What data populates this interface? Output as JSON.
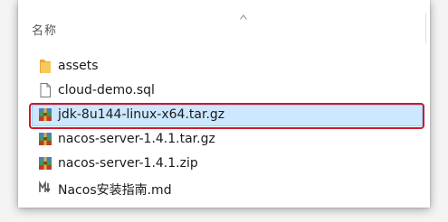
{
  "header": {
    "name_column": "名称"
  },
  "files": [
    {
      "name": "assets",
      "icon": "folder-icon"
    },
    {
      "name": "cloud-demo.sql",
      "icon": "document-icon"
    },
    {
      "name": "jdk-8u144-linux-x64.tar.gz",
      "icon": "archive-icon",
      "selected": true
    },
    {
      "name": "nacos-server-1.4.1.tar.gz",
      "icon": "archive-icon"
    },
    {
      "name": "nacos-server-1.4.1.zip",
      "icon": "archive-icon"
    },
    {
      "name": "Nacos安装指南.md",
      "icon": "markdown-icon"
    }
  ],
  "colors": {
    "selection_bg": "#cce8ff",
    "selection_border": "#99d1ff",
    "highlight": "#d0192a"
  }
}
